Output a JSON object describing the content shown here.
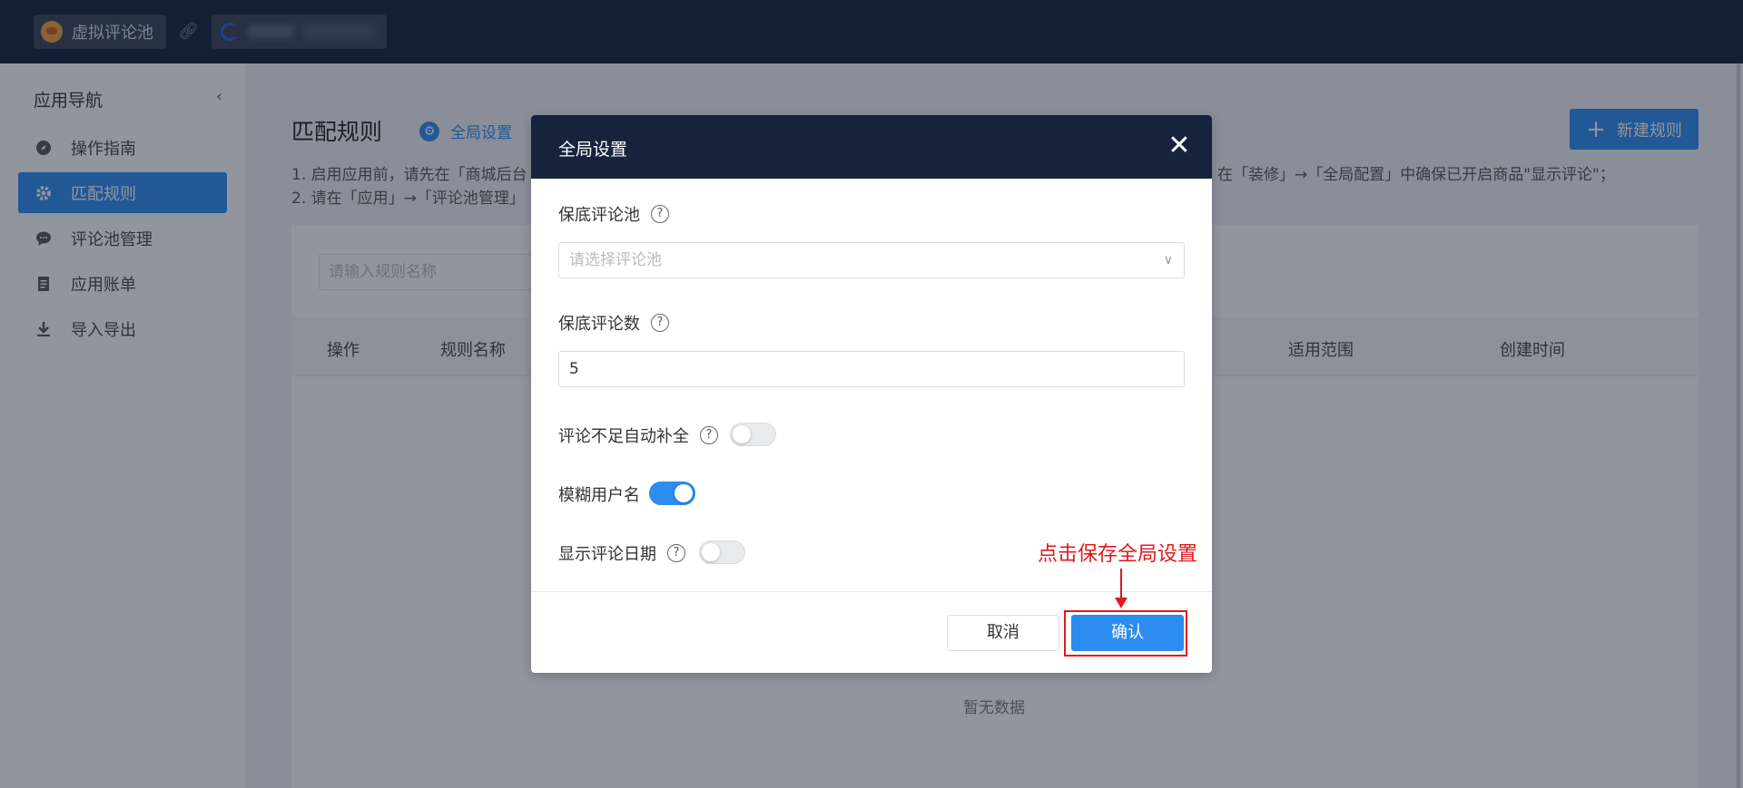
{
  "topbar": {
    "app_name": "虚拟评论池",
    "link_icon": "link-icon",
    "shop_name_obscured": true
  },
  "sidebar": {
    "title": "应用导航",
    "collapse_icon": "chevron-left-icon",
    "items": [
      {
        "label": "操作指南",
        "icon": "compass-icon",
        "active": false
      },
      {
        "label": "匹配规则",
        "icon": "gear-icon",
        "active": true
      },
      {
        "label": "评论池管理",
        "icon": "chat-bubble-icon",
        "active": false
      },
      {
        "label": "应用账单",
        "icon": "receipt-icon",
        "active": false
      },
      {
        "label": "导入导出",
        "icon": "download-icon",
        "active": false
      }
    ]
  },
  "main": {
    "title": "匹配规则",
    "global_settings_link": "全局设置",
    "new_rule_button": "新建规则",
    "tips": {
      "line1_left": "1. 启用应用前，请先在「商城后台",
      "line1_right": "在「装修」→「全局配置」中确保已开启商品\"显示评论\"；",
      "line2_left": "2. 请在「应用」→「评论池管理」"
    },
    "search_placeholder": "请输入规则名称",
    "table_headers": [
      "操作",
      "规则名称",
      "适用范围",
      "创建时间"
    ],
    "empty_text": "暂无数据"
  },
  "modal": {
    "title": "全局设置",
    "fields": {
      "fallback_pool_label": "保底评论池",
      "fallback_pool_placeholder": "请选择评论池",
      "fallback_count_label": "保底评论数",
      "fallback_count_value": "5",
      "auto_fill_label": "评论不足自动补全",
      "auto_fill_on": false,
      "blur_username_label": "模糊用户名",
      "blur_username_on": true,
      "show_date_label": "显示评论日期",
      "show_date_on": false
    },
    "cancel_button": "取消",
    "confirm_button": "确认",
    "annotation": "点击保存全局设置"
  },
  "colors": {
    "topbar": "#141f3a",
    "primary": "#2d8cf0",
    "modal_header": "#17233d",
    "annotation": "#e0191f"
  }
}
